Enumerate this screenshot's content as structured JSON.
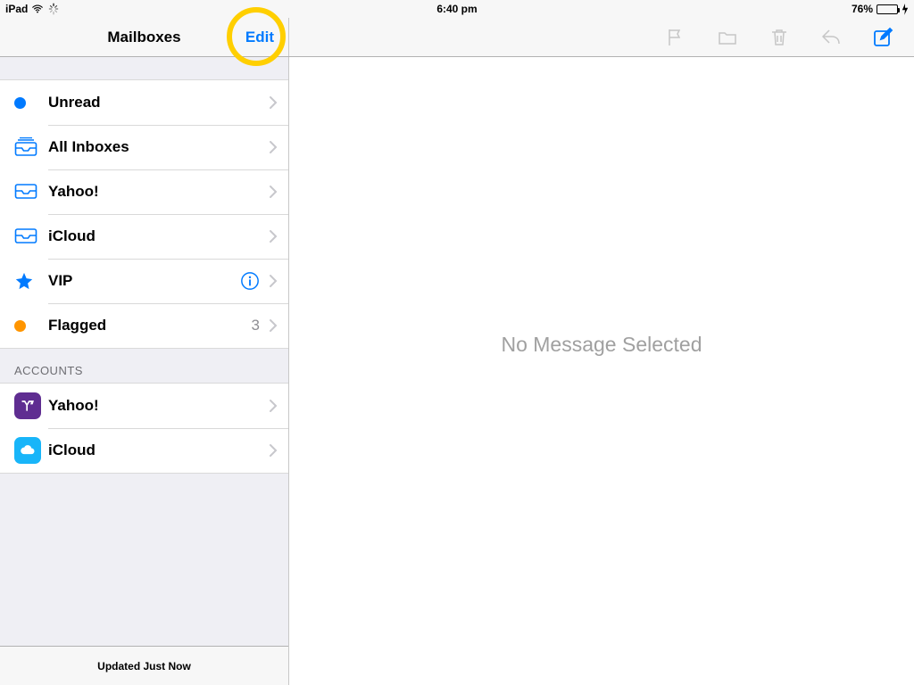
{
  "status": {
    "device": "iPad",
    "time": "6:40 pm",
    "battery_pct": "76%"
  },
  "nav": {
    "title": "Mailboxes",
    "edit_label": "Edit"
  },
  "mailboxes": [
    {
      "id": "unread",
      "label": "Unread"
    },
    {
      "id": "all-inboxes",
      "label": "All Inboxes"
    },
    {
      "id": "yahoo",
      "label": "Yahoo!"
    },
    {
      "id": "icloud",
      "label": "iCloud"
    },
    {
      "id": "vip",
      "label": "VIP"
    },
    {
      "id": "flagged",
      "label": "Flagged",
      "count": "3"
    }
  ],
  "accounts_header": "ACCOUNTS",
  "accounts": [
    {
      "id": "account-yahoo",
      "label": "Yahoo!"
    },
    {
      "id": "account-icloud",
      "label": "iCloud"
    }
  ],
  "footer": {
    "status": "Updated Just Now"
  },
  "main": {
    "placeholder": "No Message Selected"
  },
  "colors": {
    "tint": "#007aff",
    "orange": "#ff9500",
    "highlight_ring": "#ffcf00",
    "battery_fill": "#4cd964"
  }
}
